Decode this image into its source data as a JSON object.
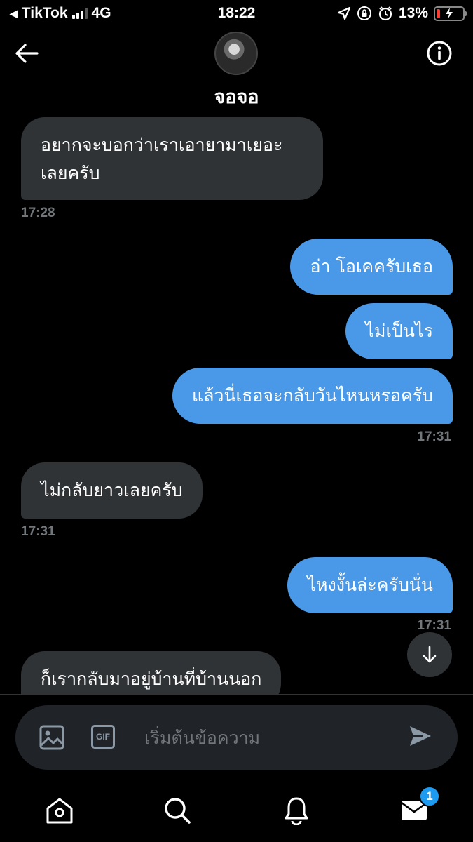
{
  "status_bar": {
    "back_app": "TikTok",
    "network": "4G",
    "time": "18:22",
    "battery_percent": "13%",
    "battery_level": 0.13
  },
  "header": {
    "contact_name": "จอจอ"
  },
  "messages": [
    {
      "direction": "in",
      "text_lines": [
        "อยากจะบอกว่าเราเอายามาเยอะ",
        "เลยครับ"
      ]
    },
    {
      "direction": "in_time",
      "time": "17:28"
    },
    {
      "direction": "out",
      "text": "อ่า โอเคครับเธอ"
    },
    {
      "direction": "out",
      "text": "ไม่เป็นไร"
    },
    {
      "direction": "out",
      "text": "แล้วนี่เธอจะกลับวันไหนหรอครับ"
    },
    {
      "direction": "out_time",
      "time": "17:31"
    },
    {
      "direction": "in",
      "text": "ไม่กลับยาวเลยครับ"
    },
    {
      "direction": "in_time",
      "time": "17:31"
    },
    {
      "direction": "out",
      "text": "ไหงงั้นล่ะครับนั่น"
    },
    {
      "direction": "out_time",
      "time": "17:31"
    },
    {
      "direction": "in",
      "text": "ก็เรากลับมาอยู่บ้านที่บ้านนอก"
    }
  ],
  "composer": {
    "placeholder": "เริ่มต้นข้อความ",
    "gif_label": "GIF"
  },
  "tabbar": {
    "messages_badge": "1"
  },
  "colors": {
    "incoming_bubble": "#2f3336",
    "outgoing_bubble": "#4a99e9",
    "timestamp": "#71767b",
    "badge": "#1d9bf0",
    "battery_low": "#ff3b30"
  },
  "icons": [
    "back-arrow-icon",
    "info-icon",
    "image-icon",
    "gif-icon",
    "send-icon",
    "scroll-down-icon",
    "home-icon",
    "search-icon",
    "bell-icon",
    "mail-icon",
    "location-arrow-icon",
    "orientation-lock-icon",
    "alarm-icon",
    "bolt-icon"
  ]
}
